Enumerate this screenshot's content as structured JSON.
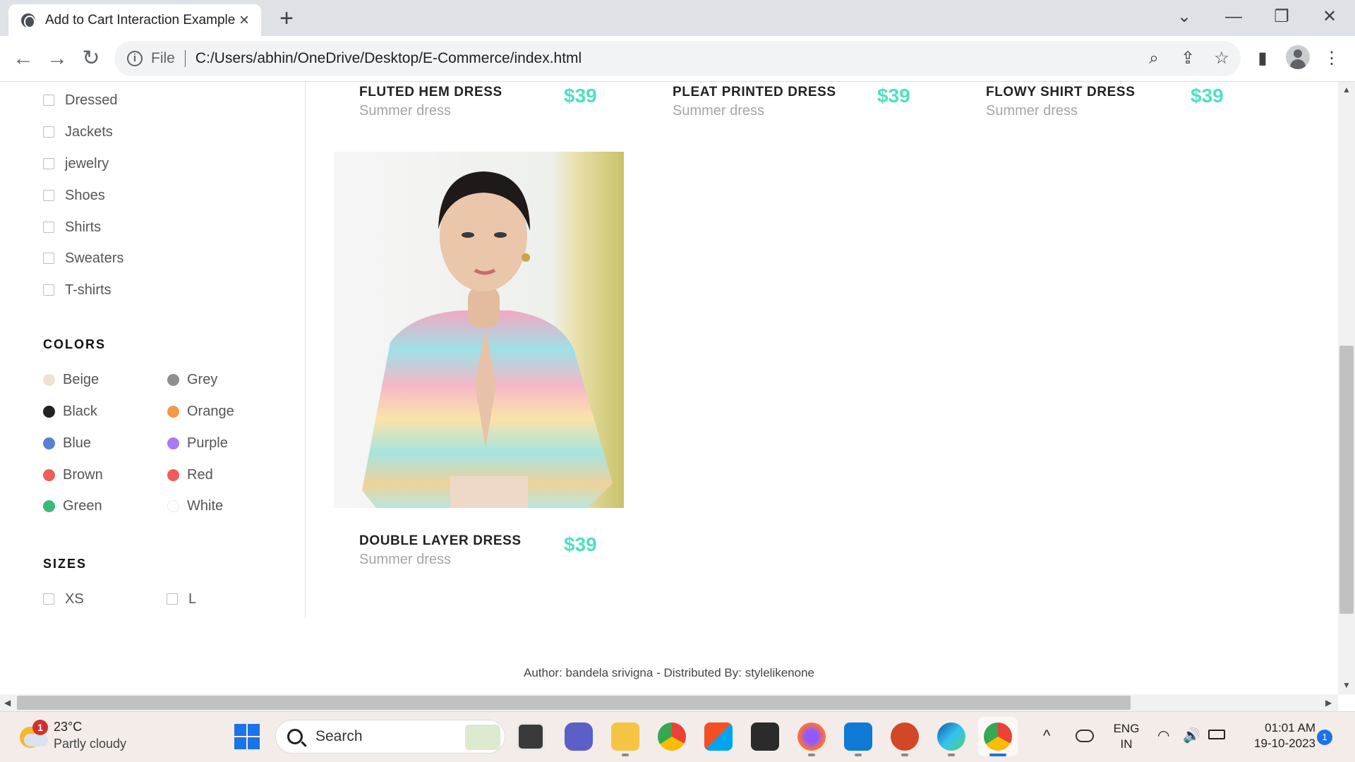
{
  "browser": {
    "tab_title": "Add to Cart Interaction Example",
    "new_tab": "+",
    "url_scheme": "File",
    "url": "C:/Users/abhin/OneDrive/Desktop/E-Commerce/index.html"
  },
  "sidebar": {
    "categories": [
      "Dressed",
      "Jackets",
      "jewelry",
      "Shoes",
      "Shirts",
      "Sweaters",
      "T-shirts"
    ],
    "colors_heading": "COLORS",
    "colors_left": [
      {
        "label": "Beige",
        "hex": "#ede3d3"
      },
      {
        "label": "Black",
        "hex": "#222222"
      },
      {
        "label": "Blue",
        "hex": "#5b7fd6"
      },
      {
        "label": "Brown",
        "hex": "#f25b5b"
      },
      {
        "label": "Green",
        "hex": "#3cb878"
      }
    ],
    "colors_right": [
      {
        "label": "Grey",
        "hex": "#8f8f8f"
      },
      {
        "label": "Orange",
        "hex": "#f2994a"
      },
      {
        "label": "Purple",
        "hex": "#a97af0"
      },
      {
        "label": "Red",
        "hex": "#f25b5b"
      },
      {
        "label": "White",
        "hex": "#ffffff"
      }
    ],
    "sizes_heading": "SIZES",
    "sizes": [
      "XS",
      "L"
    ]
  },
  "products": [
    {
      "name": "FLUTED HEM DRESS",
      "subtitle": "Summer dress",
      "price": "$39"
    },
    {
      "name": "PLEAT PRINTED DRESS",
      "subtitle": "Summer dress",
      "price": "$39"
    },
    {
      "name": "FLOWY SHIRT DRESS",
      "subtitle": "Summer dress",
      "price": "$39"
    },
    {
      "name": "DOUBLE LAYER DRESS",
      "subtitle": "Summer dress",
      "price": "$39"
    }
  ],
  "footer": "Author: bandela srivigna - Distributed By: stylelikenone",
  "taskbar": {
    "weather_temp": "23°C",
    "weather_desc": "Partly cloudy",
    "weather_badge": "1",
    "search_label": "Search",
    "lang_top": "ENG",
    "lang_bottom": "IN",
    "time": "01:01 AM",
    "date": "19-10-2023",
    "notif_count": "1"
  },
  "colors": {
    "accent_price": "#4fe0c0",
    "chrome_bg": "#dee1e6"
  }
}
